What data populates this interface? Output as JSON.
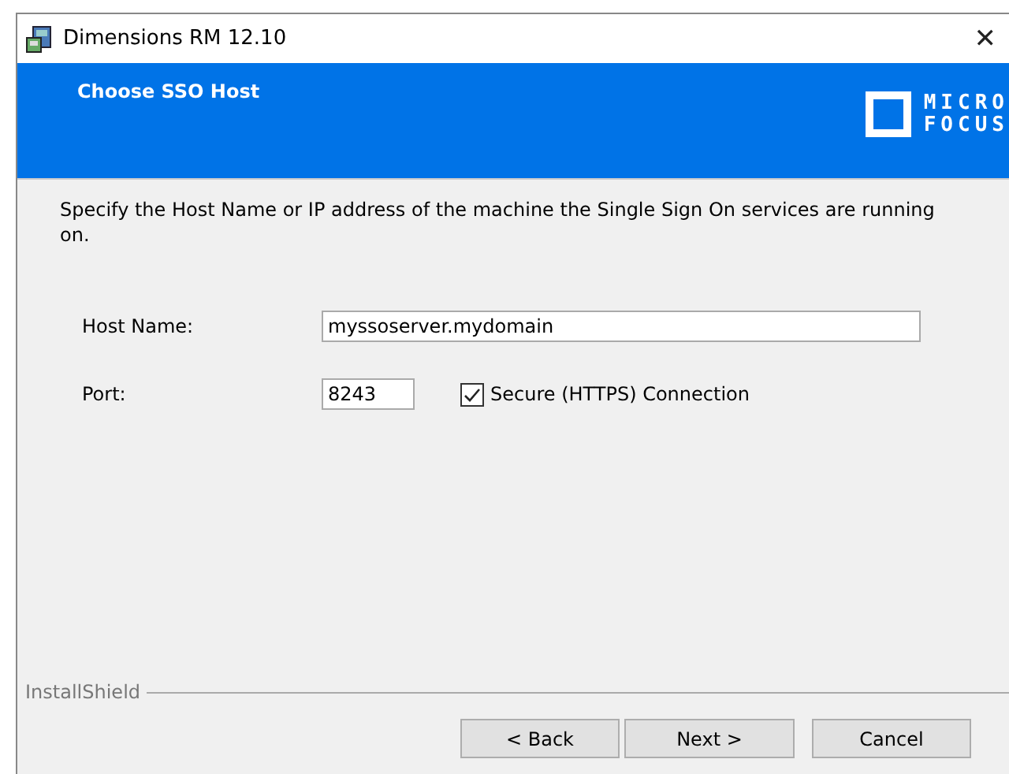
{
  "window": {
    "title": "Dimensions RM 12.10",
    "close": "✕"
  },
  "banner": {
    "title": "Choose SSO Host",
    "logo": [
      "MICRO",
      "FOCUS"
    ]
  },
  "description": "Specify the Host Name or IP address of the machine the Single Sign On services are running on.",
  "fields": [
    {
      "label": "Host Name:",
      "value": "myssoserver.mydomain",
      "kind": "wide"
    },
    {
      "label": "Port:",
      "value": "8243",
      "kind": "narrow"
    }
  ],
  "secure": {
    "label": "Secure (HTTPS) Connection",
    "checked": true
  },
  "footer": {
    "brand": "InstallShield"
  },
  "buttons": [
    "< Back",
    "Next >",
    "Cancel"
  ]
}
